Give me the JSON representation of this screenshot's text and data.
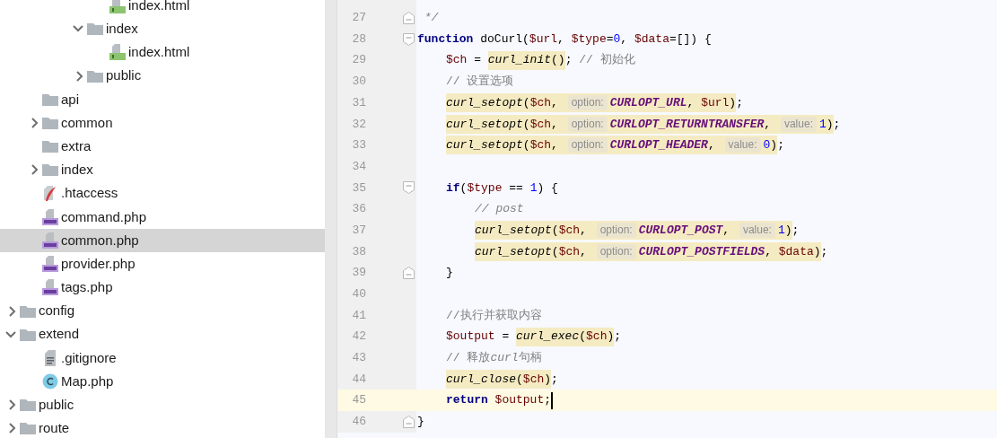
{
  "project_tree": [
    {
      "children": [
        {
          "children": [
            {
              "children": [
                {
                  "children": [
                    {
                      "label": "index.html",
                      "kind": "html",
                      "selected": false
                    }
                  ]
                },
                {
                  "label": "index",
                  "kind": "folder",
                  "expanded": true,
                  "selected": false,
                  "children": [
                    {
                      "label": "index.html",
                      "kind": "html",
                      "selected": false
                    }
                  ]
                },
                {
                  "label": "public",
                  "kind": "folder",
                  "expanded": false,
                  "selected": false
                }
              ]
            }
          ]
        },
        {
          "label": "api",
          "kind": "folder",
          "selected": false
        },
        {
          "label": "common",
          "kind": "folder",
          "expanded": false,
          "selected": false
        },
        {
          "label": "extra",
          "kind": "folder",
          "selected": false
        },
        {
          "label": "index",
          "kind": "folder",
          "expanded": false,
          "selected": false
        },
        {
          "label": ".htaccess",
          "kind": "feather",
          "selected": false
        },
        {
          "label": "command.php",
          "kind": "php",
          "selected": false
        },
        {
          "label": "common.php",
          "kind": "php",
          "selected": true
        },
        {
          "label": "provider.php",
          "kind": "php",
          "selected": false
        },
        {
          "label": "tags.php",
          "kind": "php",
          "selected": false
        }
      ]
    },
    {
      "label": "config",
      "kind": "folder",
      "expanded": false,
      "selected": false
    },
    {
      "label": "extend",
      "kind": "folder",
      "expanded": true,
      "selected": false,
      "children": [
        {
          "label": ".gitignore",
          "kind": "text",
          "selected": false
        },
        {
          "label": "Map.php",
          "kind": "class",
          "selected": false
        }
      ]
    },
    {
      "label": "public",
      "kind": "folder",
      "expanded": false,
      "selected": false
    },
    {
      "label": "route",
      "kind": "folder",
      "expanded": false,
      "selected": false
    }
  ],
  "editor": {
    "lines": [
      {
        "number": "27",
        "fold_marker": {
          "kind": "end"
        },
        "tokens": [
          {
            "text": " */",
            "kind": "doc"
          }
        ]
      },
      {
        "number": "28",
        "fold_marker": {
          "kind": "start"
        },
        "tokens": [
          {
            "text": "function",
            "kind": "keyword"
          },
          {
            "text": " doCurl(",
            "kind": "plain"
          },
          {
            "text": "$url",
            "kind": "var"
          },
          {
            "text": ", ",
            "kind": "plain"
          },
          {
            "text": "$type",
            "kind": "var"
          },
          {
            "text": "=",
            "kind": "plain"
          },
          {
            "text": "0",
            "kind": "number"
          },
          {
            "text": ", ",
            "kind": "plain"
          },
          {
            "text": "$data",
            "kind": "var"
          },
          {
            "text": "=[]) {",
            "kind": "plain"
          }
        ],
        "children": [
          {
            "number": "29",
            "tokens": [
              {
                "text": "$ch",
                "kind": "var"
              },
              {
                "text": " = ",
                "kind": "plain"
              },
              {
                "kind": "highlight",
                "tokens": [
                  {
                    "text": "curl_init",
                    "kind": "function"
                  },
                  {
                    "text": "()",
                    "kind": "plain"
                  }
                ]
              },
              {
                "text": "; ",
                "kind": "plain"
              },
              {
                "text": "// 初始化",
                "kind": "comment"
              }
            ]
          },
          {
            "number": "30",
            "tokens": [
              {
                "text": "// 设置选项",
                "kind": "comment"
              }
            ]
          },
          {
            "number": "31",
            "tokens": [
              {
                "kind": "highlight",
                "tokens": [
                  {
                    "text": "curl_setopt",
                    "kind": "function"
                  },
                  {
                    "text": "(",
                    "kind": "plain"
                  },
                  {
                    "text": "$ch",
                    "kind": "var"
                  },
                  {
                    "text": ", ",
                    "kind": "plain"
                  },
                  {
                    "text": "option:",
                    "kind": "hint"
                  },
                  {
                    "text": "CURLOPT_URL",
                    "kind": "constant"
                  },
                  {
                    "text": ", ",
                    "kind": "plain"
                  },
                  {
                    "text": "$url",
                    "kind": "var"
                  },
                  {
                    "text": ")",
                    "kind": "plain"
                  }
                ]
              },
              {
                "text": ";",
                "kind": "plain"
              }
            ]
          },
          {
            "number": "32",
            "tokens": [
              {
                "kind": "highlight",
                "tokens": [
                  {
                    "text": "curl_setopt",
                    "kind": "function"
                  },
                  {
                    "text": "(",
                    "kind": "plain"
                  },
                  {
                    "text": "$ch",
                    "kind": "var"
                  },
                  {
                    "text": ", ",
                    "kind": "plain"
                  },
                  {
                    "text": "option:",
                    "kind": "hint"
                  },
                  {
                    "text": "CURLOPT_RETURNTRANSFER",
                    "kind": "constant"
                  },
                  {
                    "text": ", ",
                    "kind": "plain"
                  },
                  {
                    "text": "value:",
                    "kind": "hint"
                  },
                  {
                    "text": "1",
                    "kind": "number"
                  },
                  {
                    "text": ")",
                    "kind": "plain"
                  }
                ]
              },
              {
                "text": ";",
                "kind": "plain"
              }
            ]
          },
          {
            "number": "33",
            "tokens": [
              {
                "kind": "highlight",
                "tokens": [
                  {
                    "text": "curl_setopt",
                    "kind": "function"
                  },
                  {
                    "text": "(",
                    "kind": "plain"
                  },
                  {
                    "text": "$ch",
                    "kind": "var"
                  },
                  {
                    "text": ", ",
                    "kind": "plain"
                  },
                  {
                    "text": "option:",
                    "kind": "hint"
                  },
                  {
                    "text": "CURLOPT_HEADER",
                    "kind": "constant"
                  },
                  {
                    "text": ", ",
                    "kind": "plain"
                  },
                  {
                    "text": "value:",
                    "kind": "hint"
                  },
                  {
                    "text": "0",
                    "kind": "number"
                  },
                  {
                    "text": ")",
                    "kind": "plain"
                  }
                ]
              },
              {
                "text": ";",
                "kind": "plain"
              }
            ]
          },
          {
            "number": "34"
          },
          {
            "number": "35",
            "fold_marker": {
              "kind": "start"
            },
            "tokens": [
              {
                "text": "if",
                "kind": "keyword"
              },
              {
                "text": "(",
                "kind": "plain"
              },
              {
                "text": "$type",
                "kind": "var"
              },
              {
                "text": " == ",
                "kind": "plain"
              },
              {
                "text": "1",
                "kind": "number"
              },
              {
                "text": ") {",
                "kind": "plain"
              }
            ],
            "children": [
              {
                "number": "36",
                "tokens": [
                  {
                    "text": "// post",
                    "kind": "comment_italic"
                  }
                ]
              },
              {
                "number": "37",
                "tokens": [
                  {
                    "kind": "highlight",
                    "tokens": [
                      {
                        "text": "curl_setopt",
                        "kind": "function"
                      },
                      {
                        "text": "(",
                        "kind": "plain"
                      },
                      {
                        "text": "$ch",
                        "kind": "var"
                      },
                      {
                        "text": ", ",
                        "kind": "plain"
                      },
                      {
                        "text": "option:",
                        "kind": "hint"
                      },
                      {
                        "text": "CURLOPT_POST",
                        "kind": "constant"
                      },
                      {
                        "text": ", ",
                        "kind": "plain"
                      },
                      {
                        "text": "value:",
                        "kind": "hint"
                      },
                      {
                        "text": "1",
                        "kind": "number"
                      },
                      {
                        "text": ")",
                        "kind": "plain"
                      }
                    ]
                  },
                  {
                    "text": ";",
                    "kind": "plain"
                  }
                ]
              },
              {
                "number": "38",
                "tokens": [
                  {
                    "kind": "highlight",
                    "tokens": [
                      {
                        "text": "curl_setopt",
                        "kind": "function"
                      },
                      {
                        "text": "(",
                        "kind": "plain"
                      },
                      {
                        "text": "$ch",
                        "kind": "var"
                      },
                      {
                        "text": ", ",
                        "kind": "plain"
                      },
                      {
                        "text": "option:",
                        "kind": "hint"
                      },
                      {
                        "text": "CURLOPT_POSTFIELDS",
                        "kind": "constant"
                      },
                      {
                        "text": ", ",
                        "kind": "plain"
                      },
                      {
                        "text": "$data",
                        "kind": "var"
                      },
                      {
                        "text": ")",
                        "kind": "plain"
                      }
                    ]
                  },
                  {
                    "text": ";",
                    "kind": "plain"
                  }
                ]
              }
            ]
          },
          {
            "number": "39",
            "fold_marker": {
              "kind": "end"
            },
            "tokens": [
              {
                "text": "}",
                "kind": "plain"
              }
            ]
          },
          {
            "number": "40"
          },
          {
            "number": "41",
            "tokens": [
              {
                "text": "//执行并获取内容",
                "kind": "comment"
              }
            ]
          },
          {
            "number": "42",
            "tokens": [
              {
                "text": "$output",
                "kind": "var"
              },
              {
                "text": " = ",
                "kind": "plain"
              },
              {
                "kind": "highlight",
                "tokens": [
                  {
                    "text": "curl_exec",
                    "kind": "function"
                  },
                  {
                    "text": "(",
                    "kind": "plain"
                  },
                  {
                    "text": "$ch",
                    "kind": "var"
                  },
                  {
                    "text": ")",
                    "kind": "plain"
                  }
                ]
              },
              {
                "text": ";",
                "kind": "plain"
              }
            ]
          },
          {
            "number": "43",
            "tokens": [
              {
                "text": "// 释放",
                "kind": "comment"
              },
              {
                "text": "curl",
                "kind": "comment_italic"
              },
              {
                "text": "句柄",
                "kind": "comment"
              }
            ]
          },
          {
            "number": "44",
            "tokens": [
              {
                "kind": "highlight",
                "tokens": [
                  {
                    "text": "curl_close",
                    "kind": "function"
                  },
                  {
                    "text": "(",
                    "kind": "plain"
                  },
                  {
                    "text": "$ch",
                    "kind": "var"
                  },
                  {
                    "text": ")",
                    "kind": "plain"
                  }
                ]
              },
              {
                "text": ";",
                "kind": "plain"
              }
            ]
          },
          {
            "number": "45",
            "current": true,
            "tokens": [
              {
                "text": "return",
                "kind": "keyword"
              },
              {
                "text": " $output",
                "kind": "var"
              },
              {
                "text": ";",
                "kind": "plain"
              }
            ]
          }
        ]
      },
      {
        "number": "46",
        "fold_marker": {
          "kind": "end"
        },
        "tokens": [
          {
            "text": "}",
            "kind": "plain"
          }
        ]
      }
    ]
  }
}
